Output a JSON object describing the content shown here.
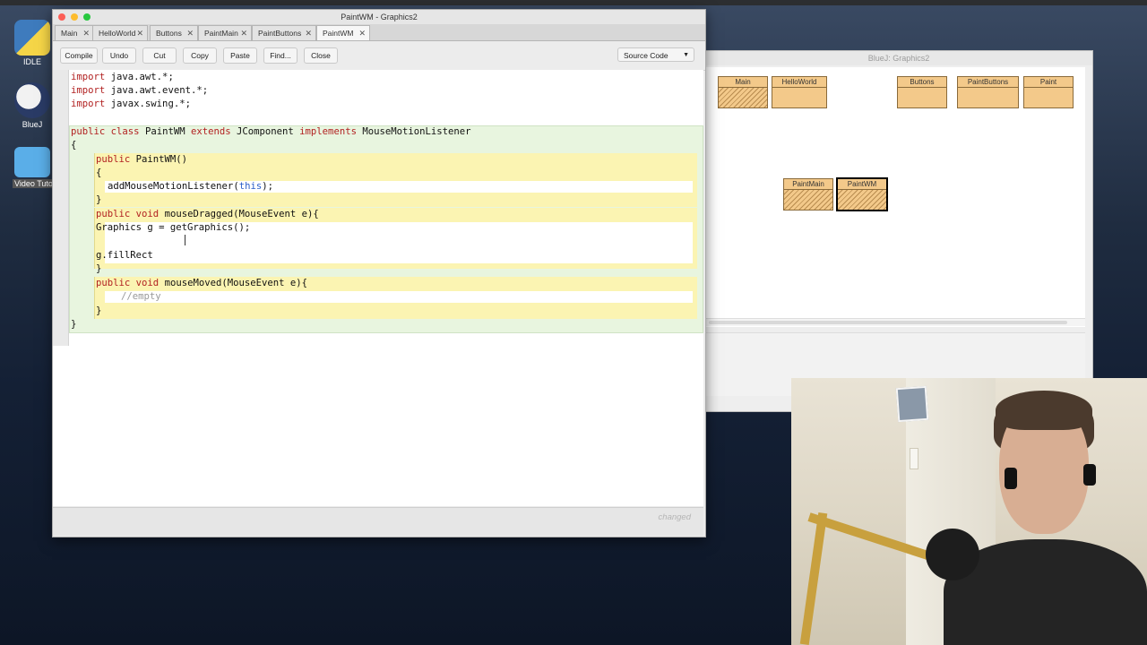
{
  "desktop": {
    "icons": [
      {
        "label": "IDLE"
      },
      {
        "label": "BlueJ"
      },
      {
        "label": "Video Tutori"
      }
    ]
  },
  "bluej_window": {
    "title": "BlueJ: Graphics2",
    "classes": [
      {
        "name": "Main",
        "stale": true,
        "selected": false
      },
      {
        "name": "HelloWorld",
        "stale": false,
        "selected": false
      },
      {
        "name": "Buttons",
        "stale": false,
        "selected": false
      },
      {
        "name": "PaintButtons",
        "stale": false,
        "selected": false
      },
      {
        "name": "Paint",
        "stale": false,
        "selected": false
      },
      {
        "name": "PaintMain",
        "stale": true,
        "selected": false
      },
      {
        "name": "PaintWM",
        "stale": true,
        "selected": true
      }
    ]
  },
  "editor": {
    "title": "PaintWM - Graphics2",
    "tabs": [
      {
        "label": "Main"
      },
      {
        "label": "HelloWorld"
      },
      {
        "label": "Buttons"
      },
      {
        "label": "PaintMain"
      },
      {
        "label": "PaintButtons"
      },
      {
        "label": "PaintWM",
        "active": true
      }
    ],
    "toolbar": {
      "compile": "Compile",
      "undo": "Undo",
      "cut": "Cut",
      "copy": "Copy",
      "paste": "Paste",
      "find": "Find...",
      "close": "Close",
      "view_select": "Source Code"
    },
    "code": {
      "import1_kw": "import",
      "import1": " java.awt.*;",
      "import2_kw": "import",
      "import2": " java.awt.event.*;",
      "import3_kw": "import",
      "import3": " javax.swing.*;",
      "class_public": "public",
      "class_kw": "class",
      "class_name": " PaintWM ",
      "class_extends": "extends",
      "class_super": " JComponent ",
      "class_implements": "implements",
      "class_iface": " MouseMotionListener",
      "open_brace": "{",
      "ctor_public": "public",
      "ctor_sig": " PaintWM()",
      "ctor_open": "{",
      "ctor_body": "addMouseMotionListener(",
      "ctor_this": "this",
      "ctor_body_end": ");",
      "ctor_close": "}",
      "m1_public": "public",
      "m1_void": "void",
      "m1_sig": " mouseDragged(MouseEvent e){",
      "m1_line1": "Graphics g = getGraphics();",
      "m1_line2": "g.fillRect",
      "m1_close": "}",
      "m2_public": "public",
      "m2_void": "void",
      "m2_sig": " mouseMoved(MouseEvent e){",
      "m2_comment": "//empty",
      "m2_close": "}",
      "close_brace": "}"
    },
    "status": "changed"
  },
  "colors": {
    "keyword": "#b22222",
    "class_scope": "#e8f5df",
    "method_scope": "#fbf4b2",
    "class_box": "#f3c98a"
  }
}
